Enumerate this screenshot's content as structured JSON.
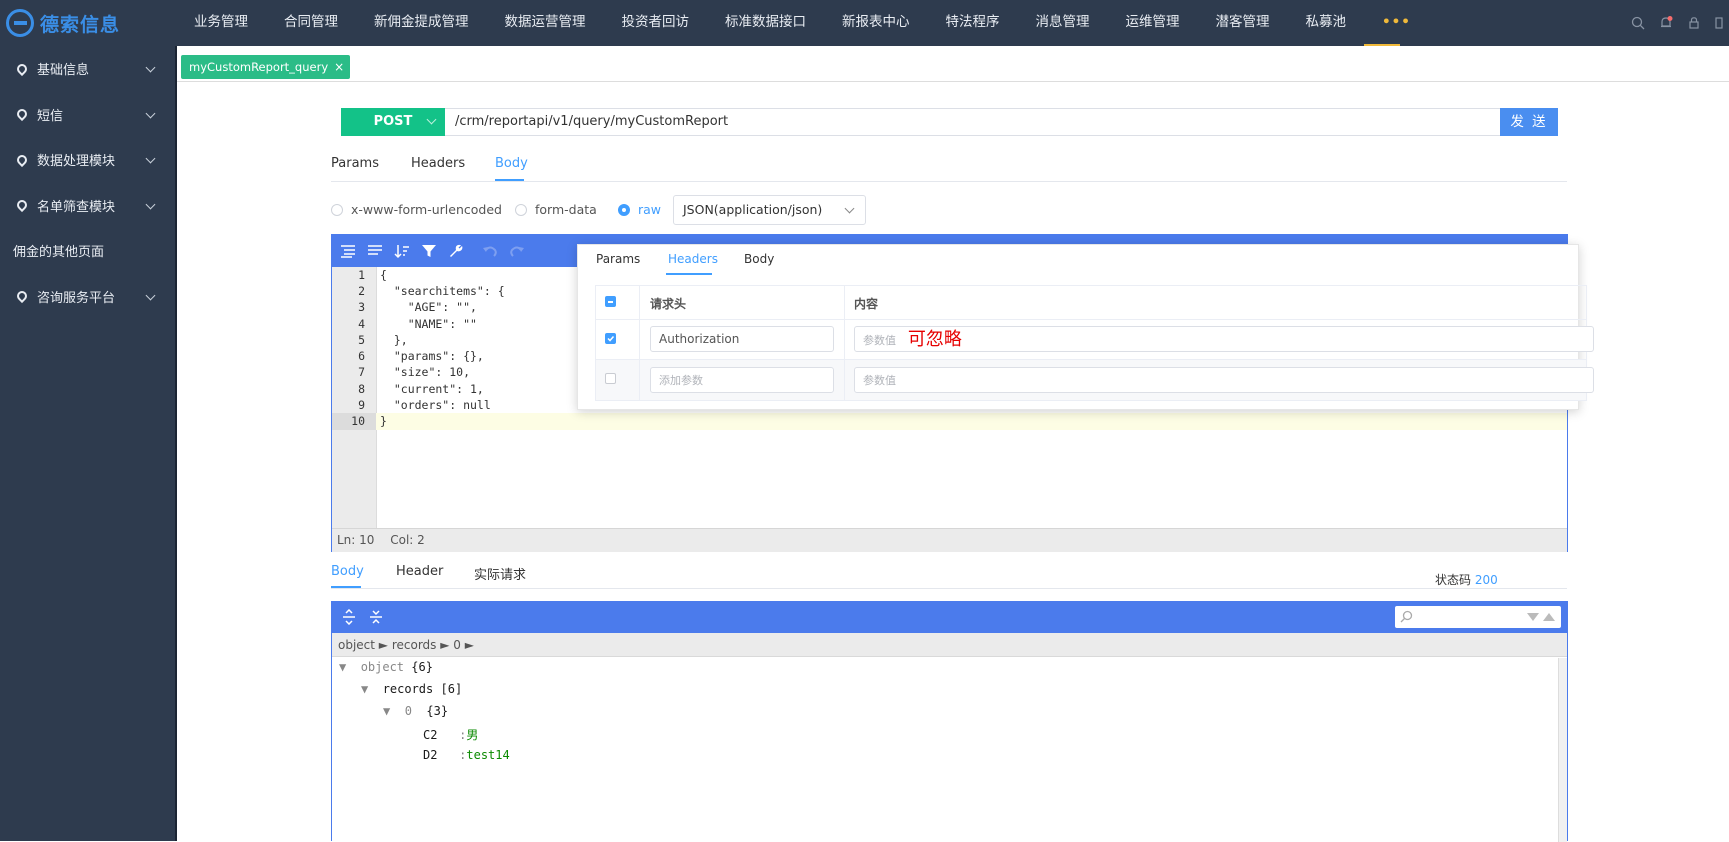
{
  "brand": {
    "name": "德索信息"
  },
  "topnav": {
    "items": [
      "业务管理",
      "合同管理",
      "新佣金提成管理",
      "数据运营管理",
      "投资者回访",
      "标准数据接口",
      "新报表中心",
      "特法程序",
      "消息管理",
      "运维管理",
      "潜客管理",
      "私募池"
    ],
    "more": "•••"
  },
  "sidebar": {
    "items": [
      {
        "label": "基础信息"
      },
      {
        "label": "短信"
      },
      {
        "label": "数据处理模块"
      },
      {
        "label": "名单筛查模块"
      }
    ],
    "plain_item": "佣金的其他页面",
    "last_item": "咨询服务平台"
  },
  "page_tab": {
    "label": "myCustomReport_query",
    "close": "×"
  },
  "request": {
    "method": "POST",
    "url": "/crm/reportapi/v1/query/myCustomReport",
    "send_label": "发 送"
  },
  "request_tabs": {
    "params": "Params",
    "headers": "Headers",
    "body": "Body"
  },
  "body_types": {
    "urlencoded": "x-www-form-urlencoded",
    "formdata": "form-data",
    "raw": "raw",
    "content_type": "JSON(application/json)"
  },
  "editor": {
    "line_numbers": [
      "1",
      "2",
      "3",
      "4",
      "5",
      "6",
      "7",
      "8",
      "9",
      "10"
    ],
    "lines": [
      "{",
      "  \"searchitems\": {",
      "    \"AGE\": \"\",",
      "    \"NAME\": \"\"",
      "  },",
      "  \"params\": {},",
      "  \"size\": 10,",
      "  \"current\": 1,",
      "  \"orders\": null",
      "}"
    ],
    "status": {
      "ln": "Ln: 10",
      "col": "Col: 2"
    }
  },
  "popup": {
    "tabs": {
      "params": "Params",
      "headers": "Headers",
      "body": "Body"
    },
    "col_header": "请求头",
    "col_content": "内容",
    "rows": [
      {
        "key": "Authorization",
        "value_placeholder": "参数值",
        "note": "可忽略",
        "checked": true
      },
      {
        "key_placeholder": "添加参数",
        "value_placeholder": "参数值",
        "checked": false
      }
    ]
  },
  "response": {
    "tabs": {
      "body": "Body",
      "header": "Header",
      "actual": "实际请求"
    },
    "status_label": "状态码",
    "status_code": "200"
  },
  "viewer": {
    "breadcrumb": "object ► records ► 0 ►",
    "tree": [
      {
        "toggle": "▼",
        "key": "object",
        "meta": "{6}"
      },
      {
        "toggle": "▼",
        "key": "records",
        "meta": "[6]"
      },
      {
        "toggle": "▼",
        "key": "0",
        "meta": "{3}"
      },
      {
        "key": "C2",
        "sep": ":",
        "value": "男"
      },
      {
        "key": "D2",
        "sep": ":",
        "value": "test14"
      }
    ]
  },
  "colors": {
    "topbar": "#2e3b4e",
    "accent": "#409eff",
    "method": "#13c288",
    "send": "#4a8ef0",
    "tab": "#2bbc87",
    "note": "#e60000"
  }
}
